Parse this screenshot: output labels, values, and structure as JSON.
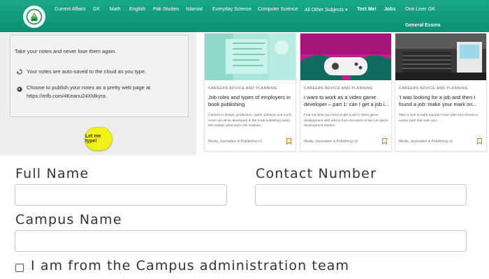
{
  "nav": {
    "logo_icon": "site-logo",
    "items": [
      {
        "label": "Current Affairs"
      },
      {
        "label": "GK"
      },
      {
        "label": "Math"
      },
      {
        "label": "English"
      },
      {
        "label": "Pak Studies"
      },
      {
        "label": "Islamiat"
      },
      {
        "label": "Everyday Science"
      },
      {
        "label": "Computer Science"
      },
      {
        "label": "All Other Subjects ▾"
      },
      {
        "label": "Test Me!"
      },
      {
        "label": "Jobs"
      },
      {
        "label": "One Liner GK"
      },
      {
        "label": "General Exams"
      }
    ],
    "color": "#13a084"
  },
  "notes": {
    "title": "Take your notes and never lose them again.",
    "line1": "Your notes are auto-saved to the cloud as you type.",
    "line2a": "Choose to publish your notes as a pretty web page at",
    "line2b": "https://mfb.com/4Keanu24XMkyra.",
    "button": "Let me type!",
    "button_color": "#f2f21a"
  },
  "cards": [
    {
      "category": "CAREERS ADVICE AND PLANNING",
      "title": "Job roles and types of employers in book publishing",
      "desc": "Careers in design, production, rights, publicity and much more can all be developed in the book publishing world. We explain what each role involves...",
      "meta": "Media, Journalism & Publishing +3"
    },
    {
      "category": "CAREERS ADVICE AND PLANNING",
      "title": "I want to work as a video game developer – part 1: can I get a job i...",
      "desc": "Find out what you need to get a job in video game development with advice from recruiters at two UK game development studios.",
      "meta": "Media, Journalism & Publishing +3"
    },
    {
      "category": "CAREERS ADVICE AND PLANNING",
      "title": "'I was looking for a job and then I found a job: make your mark on...",
      "desc": "Take a look at eight popular music jobs and choose a career path that suits you.",
      "meta": "Media, Journalism & Publishing +3"
    }
  ],
  "form": {
    "full_name_label": "Full Name",
    "contact_label": "Contact Number",
    "campus_label": "Campus Name",
    "full_name_value": "",
    "contact_value": "",
    "campus_value": "",
    "checkbox_label": "I am from the Campus administration team"
  }
}
